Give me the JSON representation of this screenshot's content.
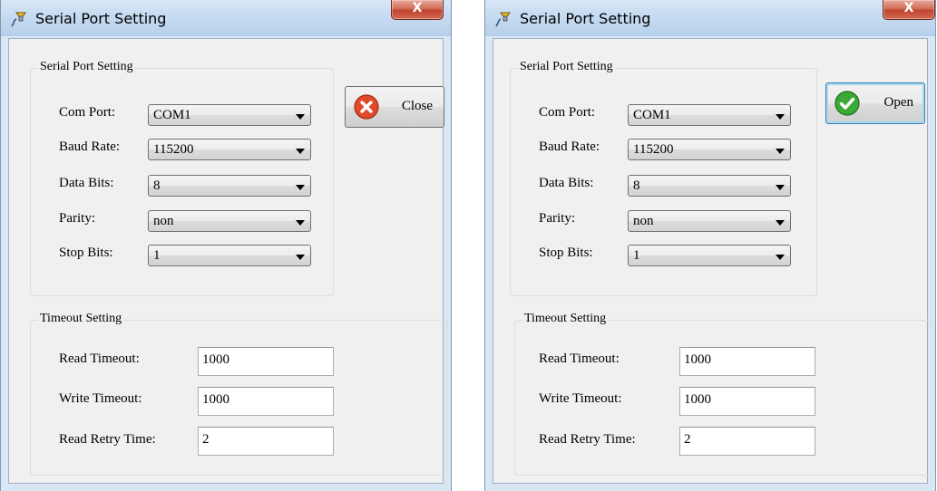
{
  "colors": {
    "window_frame": "#d9e6f4",
    "client_bg": "#f0f0f0",
    "close_button_red": "#c0432d",
    "error_icon": "#e04a2a",
    "ok_icon": "#3aa935"
  },
  "windows": [
    {
      "title": "Serial Port Setting",
      "title_icon": "cable-plug-icon",
      "close_glyph": "X",
      "serial_group": {
        "title": "Serial Port Setting",
        "fields": [
          {
            "label": "Com Port:",
            "value": "COM1"
          },
          {
            "label": "Baud Rate:",
            "value": "115200"
          },
          {
            "label": "Data Bits:",
            "value": "8"
          },
          {
            "label": "Parity:",
            "value": "non"
          },
          {
            "label": "Stop Bits:",
            "value": "1"
          }
        ]
      },
      "action_button": {
        "label": "Close",
        "icon": "error-circle-x-icon"
      },
      "timeout_group": {
        "title": "Timeout Setting",
        "fields": [
          {
            "label": "Read Timeout:",
            "value": "1000"
          },
          {
            "label": "Write Timeout:",
            "value": "1000"
          },
          {
            "label": "Read Retry Time:",
            "value": "2"
          }
        ]
      }
    },
    {
      "title": "Serial Port Setting",
      "title_icon": "cable-plug-icon",
      "close_glyph": "X",
      "serial_group": {
        "title": "Serial Port Setting",
        "fields": [
          {
            "label": "Com Port:",
            "value": "COM1"
          },
          {
            "label": "Baud Rate:",
            "value": "115200"
          },
          {
            "label": "Data Bits:",
            "value": "8"
          },
          {
            "label": "Parity:",
            "value": "non"
          },
          {
            "label": "Stop Bits:",
            "value": "1"
          }
        ]
      },
      "action_button": {
        "label": "Open",
        "icon": "check-circle-icon"
      },
      "timeout_group": {
        "title": "Timeout Setting",
        "fields": [
          {
            "label": "Read Timeout:",
            "value": "1000"
          },
          {
            "label": "Write Timeout:",
            "value": "1000"
          },
          {
            "label": "Read Retry Time:",
            "value": "2"
          }
        ]
      }
    }
  ]
}
